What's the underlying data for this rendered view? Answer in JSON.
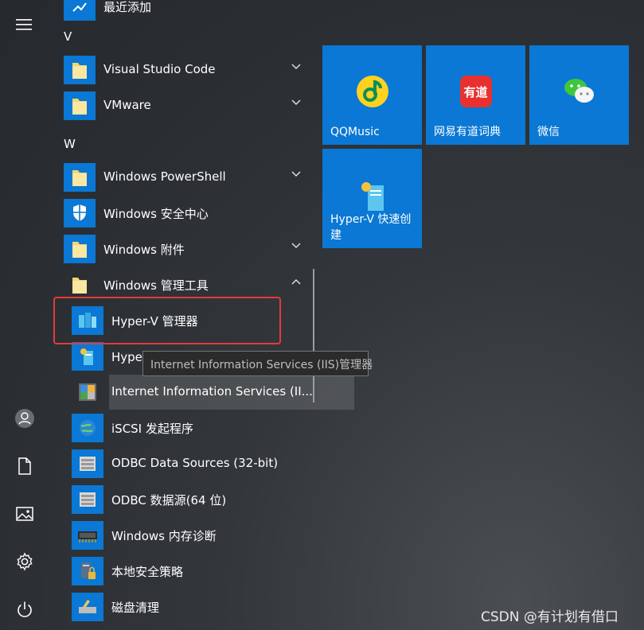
{
  "colors": {
    "accent": "#0a78d4",
    "highlight": "#e53a3a"
  },
  "list": {
    "top_item": "最近添加",
    "sections": [
      {
        "letter": "V",
        "items": [
          {
            "label": "Visual Studio Code",
            "expandable": true
          },
          {
            "label": "VMware",
            "expandable": true
          }
        ]
      },
      {
        "letter": "W",
        "items": [
          {
            "label": "Windows PowerShell",
            "expandable": true
          },
          {
            "label": "Windows 安全中心",
            "expandable": false
          },
          {
            "label": "Windows 附件",
            "expandable": true
          },
          {
            "label": "Windows 管理工具",
            "expandable": true,
            "expanded": true
          }
        ]
      }
    ],
    "submenu": [
      "Hyper-V 管理器",
      "Hyper-V 快速创建",
      "Internet Information Services (II...",
      "iSCSI 发起程序",
      "ODBC Data Sources (32-bit)",
      "ODBC 数据源(64 位)",
      "Windows 内存诊断",
      "本地安全策略",
      "磁盘清理"
    ]
  },
  "tooltip": "Internet Information Services (IIS)管理器",
  "tiles": [
    {
      "label": "QQMusic",
      "icon": "qqmusic-icon"
    },
    {
      "label": "网易有道词典",
      "icon": "youdao-icon",
      "icon_text": "有道"
    },
    {
      "label": "微信",
      "icon": "wechat-icon"
    },
    {
      "label": "Hyper-V 快速创建",
      "icon": "hyperv-quick-create-icon"
    }
  ],
  "rail": {
    "icons": [
      "hamburger-menu-icon",
      "user-icon",
      "documents-icon",
      "pictures-icon",
      "settings-icon",
      "power-icon"
    ]
  },
  "watermark": "CSDN @有计划有借口"
}
